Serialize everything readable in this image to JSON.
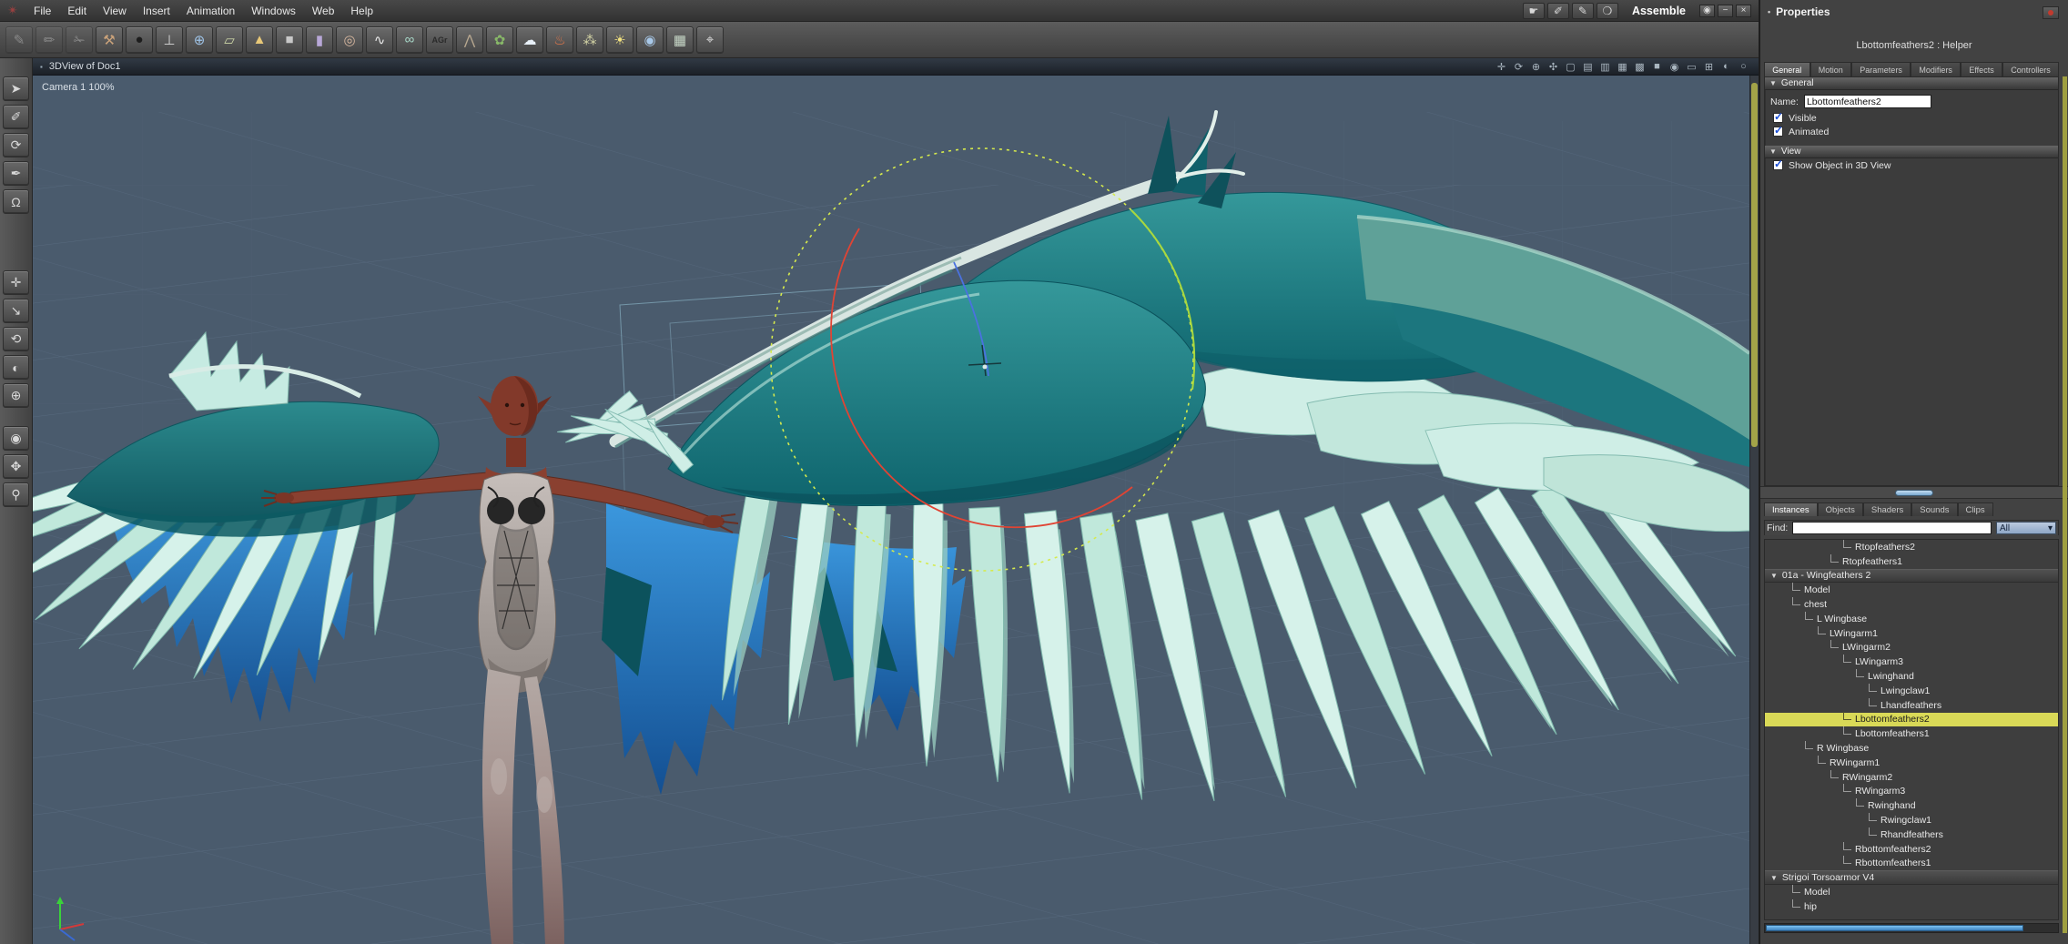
{
  "menu_bar": {
    "logo_glyph": "✴",
    "items": [
      "File",
      "Edit",
      "View",
      "Insert",
      "Animation",
      "Windows",
      "Web",
      "Help"
    ],
    "rooms": [
      {
        "name": "assemble-room-icon",
        "glyph": "☛"
      },
      {
        "name": "model-room-icon",
        "glyph": "✐"
      },
      {
        "name": "texture-room-icon",
        "glyph": "✎"
      },
      {
        "name": "render-room-icon",
        "glyph": "❍"
      }
    ],
    "mode_label": "Assemble",
    "window_icons": [
      {
        "name": "eye-icon",
        "glyph": "◉"
      },
      {
        "name": "minimize-icon",
        "glyph": "−"
      },
      {
        "name": "close-icon",
        "glyph": "×"
      }
    ]
  },
  "toolbar": {
    "icons": [
      {
        "name": "wireframe-modeler-icon",
        "glyph": "✎",
        "muted": true
      },
      {
        "name": "spline-modeler-icon",
        "glyph": "✏",
        "muted": true
      },
      {
        "name": "metaball-modeler-icon",
        "glyph": "✁",
        "muted": true
      },
      {
        "name": "axe-tool-icon",
        "glyph": "⚒",
        "color": "#caa27a"
      },
      {
        "name": "insert-sphere-icon",
        "glyph": "●",
        "color": "#1d1d1d"
      },
      {
        "name": "insert-vertex-object-icon",
        "glyph": "⊥",
        "color": "#d8d8d8"
      },
      {
        "name": "insert-globe-icon",
        "glyph": "⊕",
        "color": "#9fc4e8"
      },
      {
        "name": "insert-infinite-plane-icon",
        "glyph": "▱",
        "color": "#cfd8a8"
      },
      {
        "name": "insert-cone-icon",
        "glyph": "▲",
        "color": "#e8c878"
      },
      {
        "name": "insert-cube-icon",
        "glyph": "■",
        "color": "#c8c8c8"
      },
      {
        "name": "insert-cylinder-icon",
        "glyph": "▮",
        "color": "#b8a8d8"
      },
      {
        "name": "insert-torus-icon",
        "glyph": "◎",
        "color": "#d8b8a0"
      },
      {
        "name": "insert-spline-icon",
        "glyph": "∿",
        "color": "#e8e8e8"
      },
      {
        "name": "insert-metaball-icon",
        "glyph": "∞",
        "color": "#a8d8c8"
      },
      {
        "name": "insert-text-icon",
        "glyph": "AGr",
        "color": "#2a2a2a",
        "small": true
      },
      {
        "name": "insert-terrain-icon",
        "glyph": "⋀",
        "color": "#b8a890"
      },
      {
        "name": "insert-plant-icon",
        "glyph": "✿",
        "color": "#88b868"
      },
      {
        "name": "insert-cloud-icon",
        "glyph": "☁",
        "color": "#e8f0f8"
      },
      {
        "name": "insert-fire-icon",
        "glyph": "♨",
        "color": "#e87848"
      },
      {
        "name": "insert-particles-icon",
        "glyph": "⁂",
        "color": "#d8d8a8"
      },
      {
        "name": "insert-light-icon",
        "glyph": "☀",
        "color": "#f0e080"
      },
      {
        "name": "insert-camera-icon",
        "glyph": "◉",
        "color": "#a8c8e8"
      },
      {
        "name": "insert-group-icon",
        "glyph": "▦",
        "color": "#c8d8c8"
      },
      {
        "name": "insert-target-icon",
        "glyph": "⌖",
        "color": "#e0e0e0"
      }
    ]
  },
  "left_toolbar": {
    "group1": [
      {
        "name": "select-tool-icon",
        "glyph": "➤"
      },
      {
        "name": "move-vertex-tool-icon",
        "glyph": "✐"
      },
      {
        "name": "rotate-view-ball-icon",
        "glyph": "⟳"
      },
      {
        "name": "eyedropper-icon",
        "glyph": "✒"
      },
      {
        "name": "magnet-tool-icon",
        "glyph": "Ω"
      }
    ],
    "group2": [
      {
        "name": "move-tool-icon",
        "glyph": "✛"
      },
      {
        "name": "scale-tool-icon",
        "glyph": "↘"
      },
      {
        "name": "rotate-tool-icon",
        "glyph": "⟲"
      },
      {
        "name": "shader-ball-icon",
        "glyph": "◐"
      },
      {
        "name": "hot-point-tool-icon",
        "glyph": "⊕"
      }
    ],
    "group3": [
      {
        "name": "camera-tool-icon",
        "glyph": "◉"
      },
      {
        "name": "pan-tool-icon",
        "glyph": "✥"
      },
      {
        "name": "zoom-tool-icon",
        "glyph": "⚲"
      }
    ]
  },
  "viewport": {
    "title": "3DView of Doc1",
    "title_icon": "▪",
    "camera_label": "Camera 1 100%",
    "header_icons": [
      {
        "name": "track-xy-icon",
        "glyph": "✛"
      },
      {
        "name": "bank-icon",
        "glyph": "⟳"
      },
      {
        "name": "dolly-icon",
        "glyph": "⊕"
      },
      {
        "name": "fly-icon",
        "glyph": "✣"
      },
      {
        "name": "display-bbox-icon",
        "glyph": "▢"
      },
      {
        "name": "display-wireframe-icon",
        "glyph": "▤"
      },
      {
        "name": "display-hiddenline-icon",
        "glyph": "▥"
      },
      {
        "name": "display-flat-icon",
        "glyph": "▦"
      },
      {
        "name": "display-gouraud-icon",
        "glyph": "▩"
      },
      {
        "name": "display-textured-icon",
        "glyph": "■"
      },
      {
        "name": "camera-select-icon",
        "glyph": "◉"
      },
      {
        "name": "production-frame-icon",
        "glyph": "▭"
      },
      {
        "name": "grid-options-icon",
        "glyph": "⊞"
      },
      {
        "name": "render-preview-icon",
        "glyph": "◐"
      },
      {
        "name": "antialias-icon",
        "glyph": "○"
      }
    ]
  },
  "properties": {
    "title": "Properties",
    "bullet": "•",
    "object_label": "Lbottomfeathers2 : Helper",
    "collapse_tri": "▼",
    "check_glyph": "✓",
    "tabs": [
      {
        "label": "General",
        "active": true
      },
      {
        "label": "Motion"
      },
      {
        "label": "Parameters"
      },
      {
        "label": "Modifiers"
      },
      {
        "label": "Effects"
      },
      {
        "label": "Controllers"
      }
    ],
    "general": {
      "label": "General",
      "name_label": "Name:",
      "name_value": "Lbottomfeathers2",
      "checks": [
        {
          "label": "Visible",
          "checked": true
        },
        {
          "label": "Animated",
          "checked": true
        }
      ]
    },
    "view": {
      "label": "View",
      "checks": [
        {
          "label": "Show Object in 3D View",
          "checked": true
        }
      ]
    }
  },
  "instances": {
    "root_triangle": "▼",
    "tabs": [
      {
        "label": "Instances",
        "active": true
      },
      {
        "label": "Objects"
      },
      {
        "label": "Shaders"
      },
      {
        "label": "Sounds"
      },
      {
        "label": "Clips"
      }
    ],
    "find_label": "Find:",
    "find_value": "",
    "filter_value": "All",
    "filter_arrow": "▾",
    "tree": [
      {
        "label": "Rtopfeathers2",
        "depth": 5
      },
      {
        "label": "Rtopfeathers1",
        "depth": 4
      },
      {
        "label": "01a - Wingfeathers 2",
        "depth": 0,
        "root": true
      },
      {
        "label": "Model",
        "depth": 1
      },
      {
        "label": "chest",
        "depth": 1
      },
      {
        "label": "L Wingbase",
        "depth": 2
      },
      {
        "label": "LWingarm1",
        "depth": 3
      },
      {
        "label": "LWingarm2",
        "depth": 4
      },
      {
        "label": "LWingarm3",
        "depth": 5
      },
      {
        "label": "Lwinghand",
        "depth": 6
      },
      {
        "label": "Lwingclaw1",
        "depth": 7
      },
      {
        "label": "Lhandfeathers",
        "depth": 7
      },
      {
        "label": "Lbottomfeathers2",
        "depth": 5,
        "selected": true
      },
      {
        "label": "Lbottomfeathers1",
        "depth": 5
      },
      {
        "label": "R Wingbase",
        "depth": 2
      },
      {
        "label": "RWingarm1",
        "depth": 3
      },
      {
        "label": "RWingarm2",
        "depth": 4
      },
      {
        "label": "RWingarm3",
        "depth": 5
      },
      {
        "label": "Rwinghand",
        "depth": 6
      },
      {
        "label": "Rwingclaw1",
        "depth": 7
      },
      {
        "label": "Rhandfeathers",
        "depth": 7
      },
      {
        "label": "Rbottomfeathers2",
        "depth": 5
      },
      {
        "label": "Rbottomfeathers1",
        "depth": 5
      },
      {
        "label": "Strigoi Torsoarmor V4",
        "depth": 0,
        "root": true
      },
      {
        "label": "Model",
        "depth": 1
      },
      {
        "label": "hip",
        "depth": 1
      }
    ]
  },
  "colors": {
    "selection_yellow": "#d9d957",
    "membrane_blue": "#2e8ed6",
    "wing_teal": "#1f8083",
    "scroll_olive": "#a3a348"
  }
}
